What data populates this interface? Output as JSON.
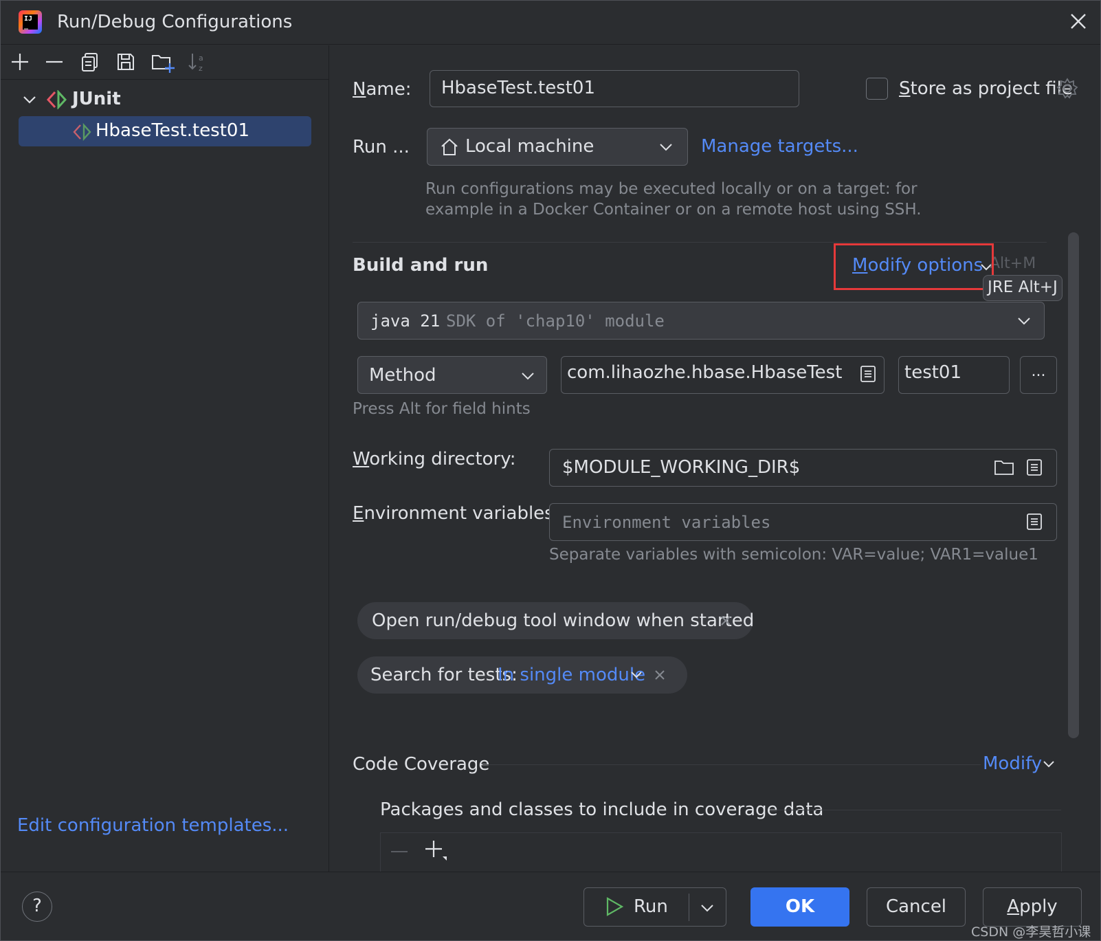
{
  "window": {
    "title": "Run/Debug Configurations"
  },
  "sidebar": {
    "tree": {
      "group_label": "JUnit",
      "selected_item": "HbaseTest.test01"
    },
    "edit_templates_link": "Edit configuration templates..."
  },
  "form": {
    "name_label_first": "N",
    "name_label_rest": "ame:",
    "name_value": "HbaseTest.test01",
    "store_label_first": "S",
    "store_label_rest": "tore as project file",
    "store_checked": false,
    "run_on_label": "Run ...",
    "target_value": "Local machine",
    "manage_targets_link": "Manage targets...",
    "target_hint_line1": "Run configurations may be executed locally or on a target: for",
    "target_hint_line2": "example in a Docker Container or on a remote host using SSH."
  },
  "build_and_run": {
    "section_title": "Build and run",
    "modify_options_first": "M",
    "modify_options_rest": "odify options",
    "modify_shortcut": "Alt+M",
    "jre_tooltip": "JRE Alt+J",
    "jdk_version": "java 21",
    "jdk_desc": "SDK of 'chap10' module",
    "test_kind": "Method",
    "class_value": "com.lihaozhe.hbase.HbaseTest",
    "method_value": "test01",
    "more_button": "...",
    "field_hint": "Press Alt for field hints",
    "working_dir_label_first": "W",
    "working_dir_label_rest": "orking directory:",
    "working_dir_value": "$MODULE_WORKING_DIR$",
    "env_label_first": "E",
    "env_label_rest": "nvironment variables:",
    "env_placeholder": "Environment variables",
    "env_hint": "Separate variables with semicolon: VAR=value; VAR1=value1",
    "chip_open_window": "Open run/debug tool window when started",
    "chip_search_label": "Search for tests:",
    "chip_search_value": "In single module"
  },
  "coverage": {
    "title": "Code Coverage",
    "modify_link": "Modify",
    "packages_label": "Packages and classes to include in coverage data"
  },
  "footer": {
    "help": "?",
    "run_button": "Run",
    "ok_button": "OK",
    "cancel_button": "Cancel",
    "apply_button_first": "A",
    "apply_button_rest": "pply"
  },
  "watermark": "CSDN @李昊哲小课",
  "colors": {
    "background": "#2b2d30",
    "accent": "#3574f0",
    "link": "#548af7",
    "selection": "#2e436e",
    "highlight_box": "#e5393a"
  }
}
